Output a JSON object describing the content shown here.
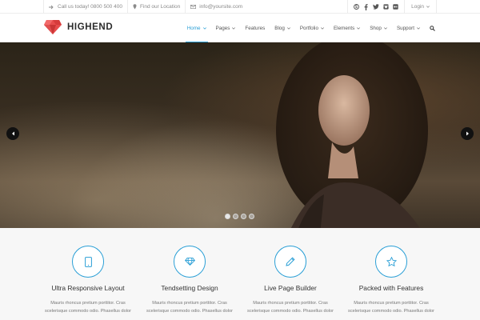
{
  "topbar": {
    "phone_text": "Call us today! 0800 500 400",
    "location_text": "Find our Location",
    "email_text": "info@yoursite.com",
    "login_label": "Login",
    "social_icons": [
      "skype-icon",
      "facebook-icon",
      "twitter-icon",
      "instagram-icon",
      "flickr-icon"
    ]
  },
  "header": {
    "logo_text": "HIGHEND",
    "nav": [
      {
        "label": "Home",
        "active": true
      },
      {
        "label": "Pages"
      },
      {
        "label": "Features"
      },
      {
        "label": "Blog"
      },
      {
        "label": "Portfolio"
      },
      {
        "label": "Elements"
      },
      {
        "label": "Shop"
      },
      {
        "label": "Support"
      }
    ],
    "accent_color": "#2a9fd6"
  },
  "hero": {
    "slide_count": 4,
    "active_slide": 1
  },
  "features": [
    {
      "icon": "tablet-icon",
      "title": "Ultra Responsive Layout",
      "text": "Mauris rhoncus pretium porttitor. Cras scelerisque commodo odio. Phasellus dolor"
    },
    {
      "icon": "diamond-icon",
      "title": "Tendsetting Design",
      "text": "Mauris rhoncus pretium porttitor. Cras scelerisque commodo odio. Phasellus dolor"
    },
    {
      "icon": "pencil-icon",
      "title": "Live Page Builder",
      "text": "Mauris rhoncus pretium porttitor. Cras scelerisque commodo odio. Phasellus dolor"
    },
    {
      "icon": "star-icon",
      "title": "Packed with Features",
      "text": "Mauris rhoncus pretium porttitor. Cras scelerisque commodo odio. Phasellus dolor"
    }
  ]
}
